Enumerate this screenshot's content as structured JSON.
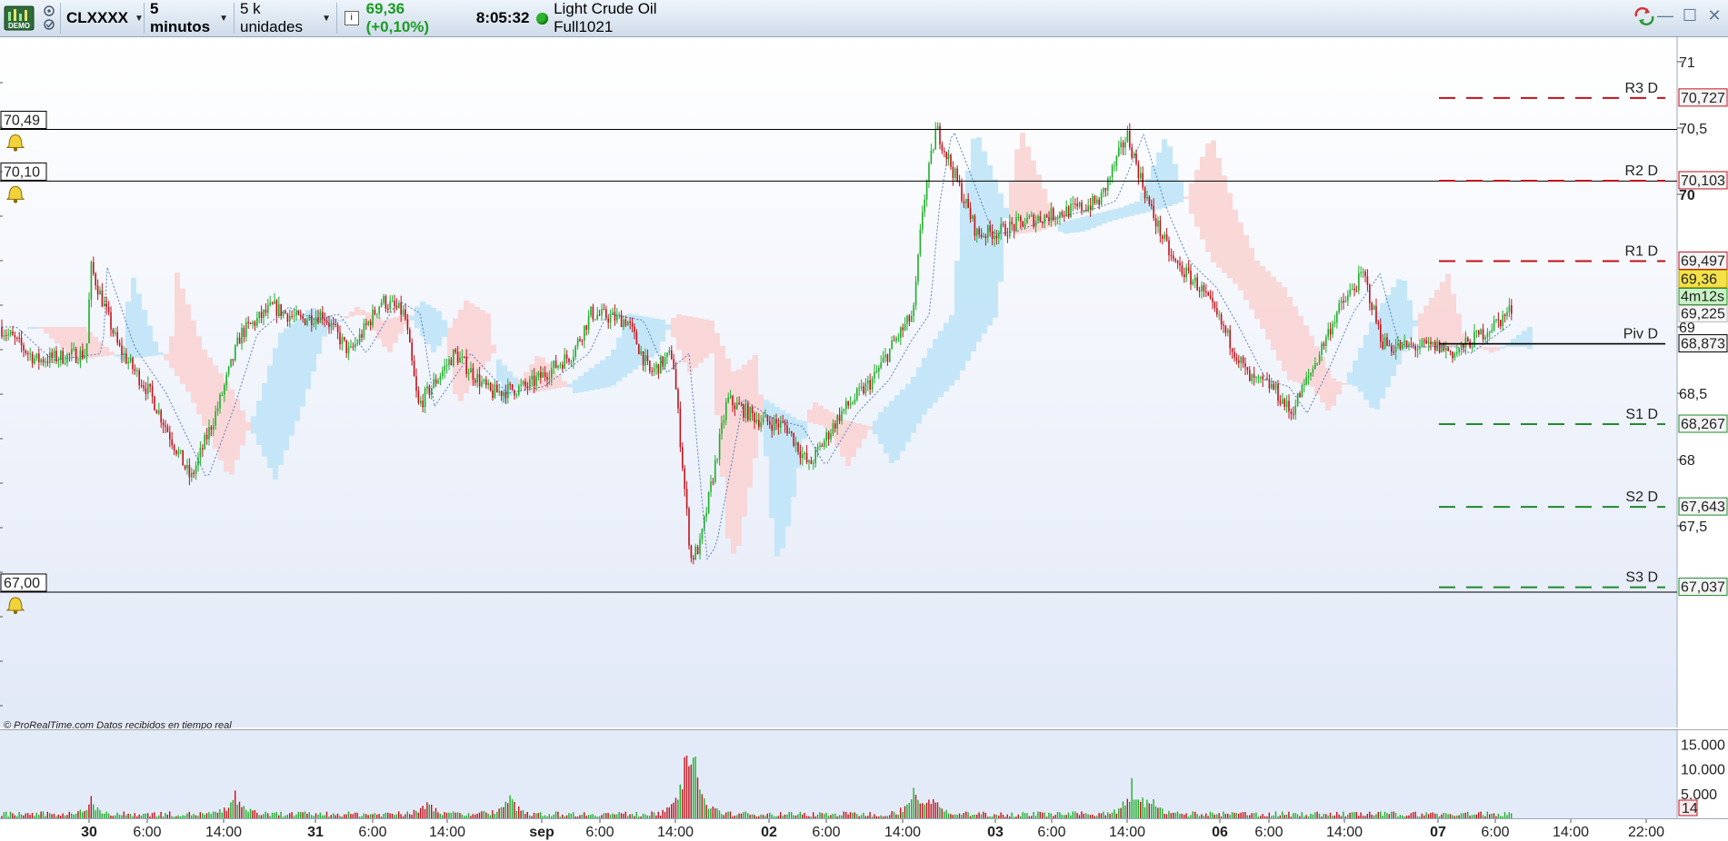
{
  "toolbar": {
    "demo_logo": "DEMO",
    "symbol": "CLXXXX",
    "timeframe": "5 minutos",
    "units": "5 k unidades",
    "price_change": "69,36 (+0,10%)",
    "clock": "8:05:32",
    "instrument_name": "Light Crude Oil Full1021",
    "icons": [
      "demo-icon",
      "alarm-icon",
      "info-icon",
      "status-dot",
      "refresh-icon",
      "minimize-icon",
      "maximize-icon",
      "close-icon"
    ]
  },
  "credit": "© ProRealTime.com  Datos recibidos en tiempo real",
  "colors": {
    "up": "#1fae2a",
    "down": "#c1121b",
    "resistance": "#c1121b",
    "support": "#1f8a2e",
    "pivot": "#000000",
    "cloud_bull": "#bfe4f7",
    "cloud_bear": "#f9d4d4",
    "bg_top": "#ffffff",
    "bg_bottom": "#e2e9f7",
    "current_price_bg": "#f4e14a"
  },
  "chart_data": {
    "type": "candlestick",
    "symbol": "CLXXXX",
    "ylim": [
      66.95,
      71.4
    ],
    "y_ticks": [
      "71",
      "70,5",
      "70",
      "69",
      "68,5",
      "68",
      "67,5"
    ],
    "y_tick_values": [
      71,
      70.5,
      70,
      69,
      68.5,
      68,
      67.5
    ],
    "x_ticks": [
      {
        "label": "30",
        "bold": true
      },
      {
        "label": "6:00",
        "bold": false
      },
      {
        "label": "14:00",
        "bold": false
      },
      {
        "label": "31",
        "bold": true
      },
      {
        "label": "6:00",
        "bold": false
      },
      {
        "label": "14:00",
        "bold": false
      },
      {
        "label": "sep",
        "bold": true
      },
      {
        "label": "6:00",
        "bold": false
      },
      {
        "label": "14:00",
        "bold": false
      },
      {
        "label": "02",
        "bold": true
      },
      {
        "label": "6:00",
        "bold": false
      },
      {
        "label": "14:00",
        "bold": false
      },
      {
        "label": "03",
        "bold": true
      },
      {
        "label": "6:00",
        "bold": false
      },
      {
        "label": "14:00",
        "bold": false
      },
      {
        "label": "06",
        "bold": true
      },
      {
        "label": "6:00",
        "bold": false
      },
      {
        "label": "14:00",
        "bold": false
      },
      {
        "label": "07",
        "bold": true
      },
      {
        "label": "6:00",
        "bold": false
      },
      {
        "label": "14:00",
        "bold": false
      },
      {
        "label": "22:00",
        "bold": false
      }
    ],
    "price_path": [
      [
        0,
        69.0
      ],
      [
        40,
        68.75
      ],
      [
        95,
        68.8
      ],
      [
        100,
        69.45
      ],
      [
        130,
        68.85
      ],
      [
        165,
        68.5
      ],
      [
        210,
        67.85
      ],
      [
        240,
        68.4
      ],
      [
        265,
        68.95
      ],
      [
        300,
        69.15
      ],
      [
        330,
        69.05
      ],
      [
        355,
        69.1
      ],
      [
        385,
        68.8
      ],
      [
        420,
        69.2
      ],
      [
        445,
        69.1
      ],
      [
        460,
        68.4
      ],
      [
        500,
        68.8
      ],
      [
        540,
        68.5
      ],
      [
        580,
        68.55
      ],
      [
        630,
        68.8
      ],
      [
        650,
        69.1
      ],
      [
        690,
        69.05
      ],
      [
        715,
        68.65
      ],
      [
        740,
        68.8
      ],
      [
        760,
        67.25
      ],
      [
        770,
        67.35
      ],
      [
        800,
        68.45
      ],
      [
        835,
        68.3
      ],
      [
        865,
        68.25
      ],
      [
        890,
        67.95
      ],
      [
        925,
        68.35
      ],
      [
        960,
        68.6
      ],
      [
        985,
        68.9
      ],
      [
        1005,
        69.1
      ],
      [
        1015,
        69.9
      ],
      [
        1030,
        70.5
      ],
      [
        1050,
        70.15
      ],
      [
        1075,
        69.7
      ],
      [
        1100,
        69.72
      ],
      [
        1130,
        69.8
      ],
      [
        1160,
        69.85
      ],
      [
        1190,
        69.9
      ],
      [
        1210,
        69.95
      ],
      [
        1240,
        70.45
      ],
      [
        1265,
        69.9
      ],
      [
        1290,
        69.5
      ],
      [
        1320,
        69.3
      ],
      [
        1345,
        69.0
      ],
      [
        1375,
        68.6
      ],
      [
        1400,
        68.55
      ],
      [
        1420,
        68.35
      ],
      [
        1445,
        68.7
      ],
      [
        1470,
        69.1
      ],
      [
        1500,
        69.4
      ],
      [
        1520,
        68.9
      ],
      [
        1530,
        68.85
      ],
      [
        1585,
        68.85
      ],
      [
        1600,
        68.8
      ],
      [
        1620,
        68.9
      ],
      [
        1650,
        69.05
      ],
      [
        1665,
        69.15
      ]
    ],
    "current_price_label": "69,36",
    "timer_label": "4m12s",
    "bid_label": "69,225",
    "horizontal_lines": [
      {
        "name": "alarm-line-upper",
        "label": "70,49",
        "value": 70.49,
        "alarm": true
      },
      {
        "name": "alarm-line-middle",
        "label": "70,10",
        "value": 70.1,
        "alarm": true
      },
      {
        "name": "alarm-line-lower",
        "label": "67,00",
        "value": 67.0,
        "alarm": true
      }
    ],
    "pivot_levels": [
      {
        "name": "R3 D",
        "value": 70.727,
        "value_label": "70,727",
        "kind": "resistance"
      },
      {
        "name": "R2 D",
        "value": 70.103,
        "value_label": "70,103",
        "kind": "resistance"
      },
      {
        "name": "R1 D",
        "value": 69.497,
        "value_label": "69,497",
        "kind": "resistance"
      },
      {
        "name": "Piv D",
        "value": 68.873,
        "value_label": "68,873",
        "kind": "pivot"
      },
      {
        "name": "S1 D",
        "value": 68.267,
        "value_label": "68,267",
        "kind": "support"
      },
      {
        "name": "S2 D",
        "value": 67.643,
        "value_label": "67,643",
        "kind": "support"
      },
      {
        "name": "S3 D",
        "value": 67.037,
        "value_label": "67,037",
        "kind": "support"
      }
    ],
    "volume": {
      "ylim": [
        0,
        18000
      ],
      "y_ticks": [
        "15.000",
        "10.000",
        "5.000"
      ],
      "y_tick_values": [
        15000,
        10000,
        5000
      ],
      "current_label": "14",
      "spikes": [
        [
          100,
          4200
        ],
        [
          260,
          5200
        ],
        [
          470,
          3800
        ],
        [
          560,
          4800
        ],
        [
          755,
          14500
        ],
        [
          765,
          11500
        ],
        [
          1005,
          6000
        ],
        [
          1025,
          5000
        ],
        [
          1245,
          7200
        ],
        [
          1265,
          4500
        ]
      ]
    }
  }
}
